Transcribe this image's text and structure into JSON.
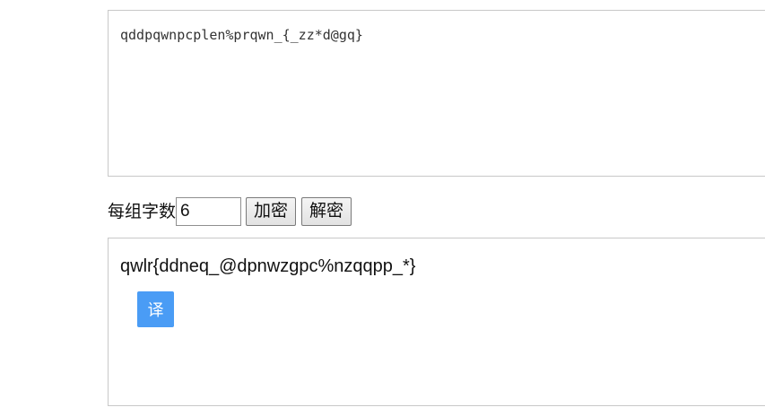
{
  "input": {
    "value": "qddpqwnpcplen%prqwn_{_zz*d@gq}"
  },
  "controls": {
    "group_label": "每组字数",
    "group_size_value": "6",
    "encrypt_label": "加密",
    "decrypt_label": "解密"
  },
  "output": {
    "value": "qwlr{ddneq_@dpnwzgpc%nzqqpp_*}",
    "translate_label": "译"
  },
  "colors": {
    "translate_button_bg": "#4a9cf5",
    "border": "#c8c8c8"
  }
}
